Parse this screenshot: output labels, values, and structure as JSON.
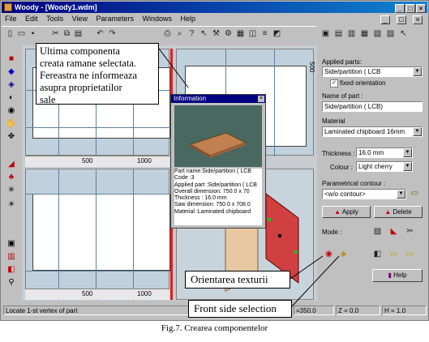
{
  "window": {
    "app_name": "Woody",
    "doc_name": "[Woody1.wdm]",
    "controls": [
      "_",
      "□",
      "×"
    ]
  },
  "menu": [
    "File",
    "Edit",
    "Tools",
    "View",
    "Parameters",
    "Windows",
    "Help"
  ],
  "toolbar": {
    "icons": [
      "new-icon",
      "open-icon",
      "save-icon",
      "cut-icon",
      "copy-icon",
      "paste-icon",
      "undo-icon",
      "redo-icon",
      "print-icon",
      "zoom-icon",
      "help-icon",
      "context-help-icon",
      "tools-icon",
      "settings-icon",
      "grid-icon",
      "view-icon",
      "cut-list-icon",
      "colors-icon"
    ]
  },
  "rulers": {
    "top_left": [
      "500",
      "1000"
    ],
    "bottom_left": [
      "500",
      "1000"
    ],
    "right_vertical": "500"
  },
  "info_window": {
    "title": "Information",
    "close": "×",
    "lines": [
      "Part name:Side/partition ( LCB",
      "Code :3",
      "Applied part :Side/partition ( LCB",
      "Overall dimension: 750.0 x 70",
      "Thickness : 16.0 mm",
      "Saw dimension: 750.0 x 708.0",
      "Material :Laminated chipboard"
    ]
  },
  "right_panel": {
    "applied_parts_label": "Applied parts:",
    "applied_parts_value": "Side/partition ( LCB",
    "fixed_orientation_label": "fixed orientation",
    "fixed_orientation_checked": true,
    "name_of_part_label": "Name of part :",
    "name_of_part_value": "Side/partition ( LCB)",
    "material_label": "Material",
    "material_value": "Laminated chipboard 16mm",
    "thickness_label": "Thickness :",
    "thickness_value": "16.0 mm",
    "colour_label": "Colour :",
    "colour_value": "Light cherry",
    "contour_label": "Parametrical contour :",
    "contour_value": "<w/o contour>",
    "apply_label": "Apply",
    "delete_label": "Delete",
    "mode_label": "Mode :",
    "help_label": "Help"
  },
  "status": {
    "message": "Locate 1-st vertex of part",
    "x": "=350.0",
    "z": "Z = 0.0",
    "h": "H = 1.0"
  },
  "callouts": {
    "top": [
      "Ultima componenta",
      "creata ramane selectata.",
      "Fereastra ne informeaza",
      "asupra proprietatilor",
      "sale"
    ],
    "texture": "Orientarea texturii",
    "front": "Front side selection"
  },
  "caption": "Fig.7. Crearea componentelor"
}
